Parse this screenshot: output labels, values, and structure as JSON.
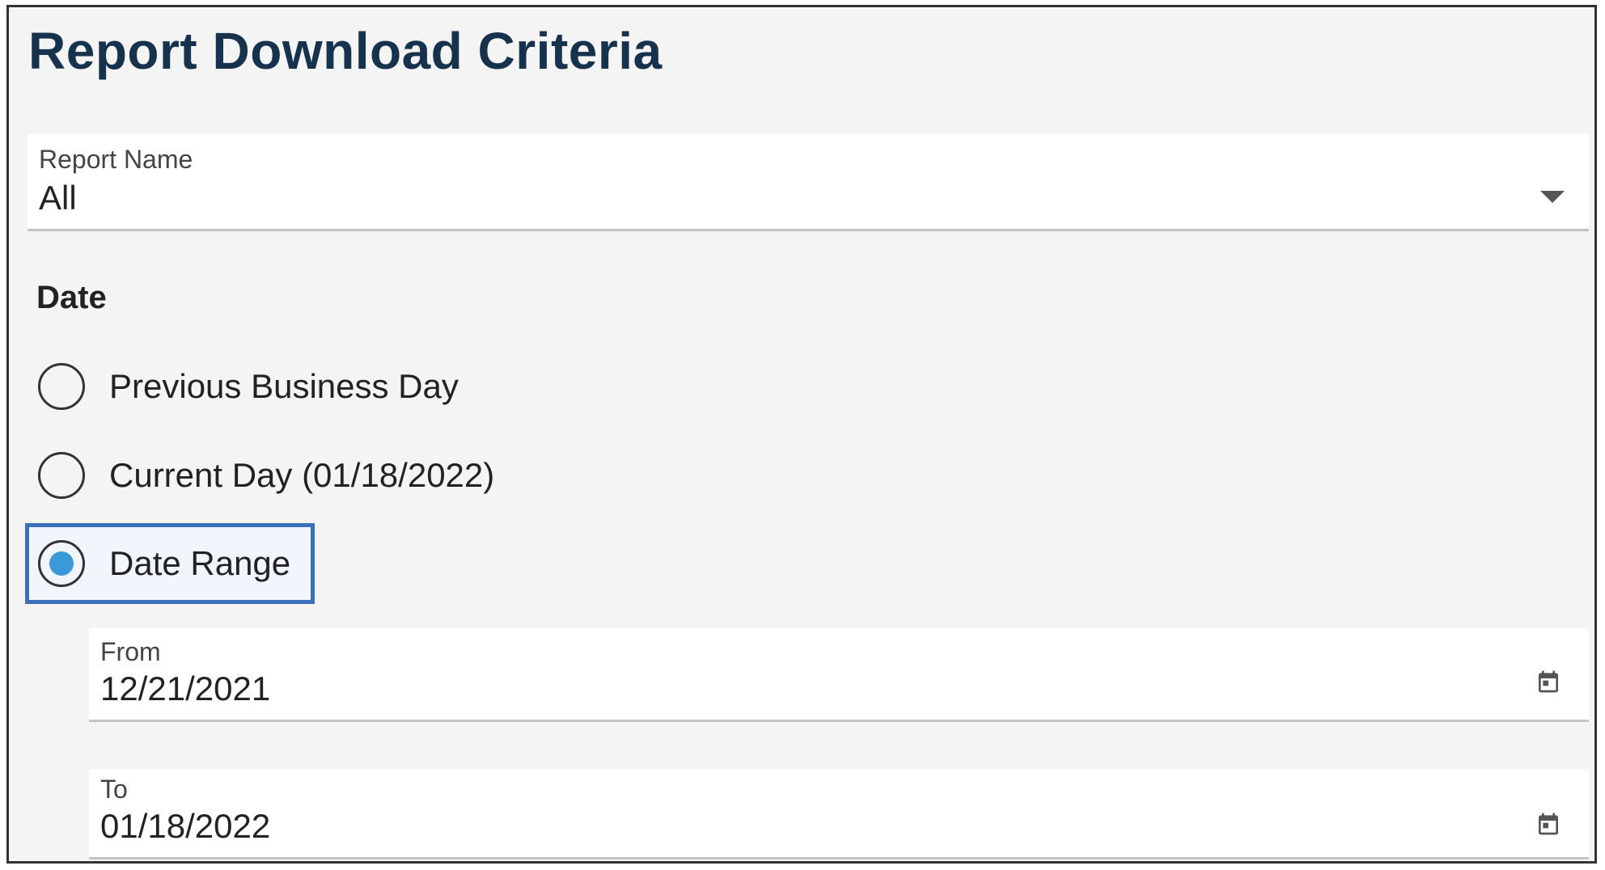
{
  "page": {
    "title": "Report Download Criteria"
  },
  "report_name": {
    "label": "Report Name",
    "value": "All",
    "icon": "chevron-down-icon"
  },
  "date": {
    "heading": "Date",
    "options": [
      {
        "label": "Previous Business Day",
        "selected": false
      },
      {
        "label": "Current Day (01/18/2022)",
        "selected": false
      },
      {
        "label": "Date Range",
        "selected": true
      }
    ],
    "from": {
      "label": "From",
      "value": "12/21/2021",
      "icon": "calendar-icon"
    },
    "to": {
      "label": "To",
      "value": "01/18/2022",
      "icon": "calendar-icon"
    }
  },
  "colors": {
    "title": "#17324d",
    "radio_selected": "#3a9ad9",
    "focus_border": "#3a70b7",
    "background": "#f4f4f4"
  }
}
